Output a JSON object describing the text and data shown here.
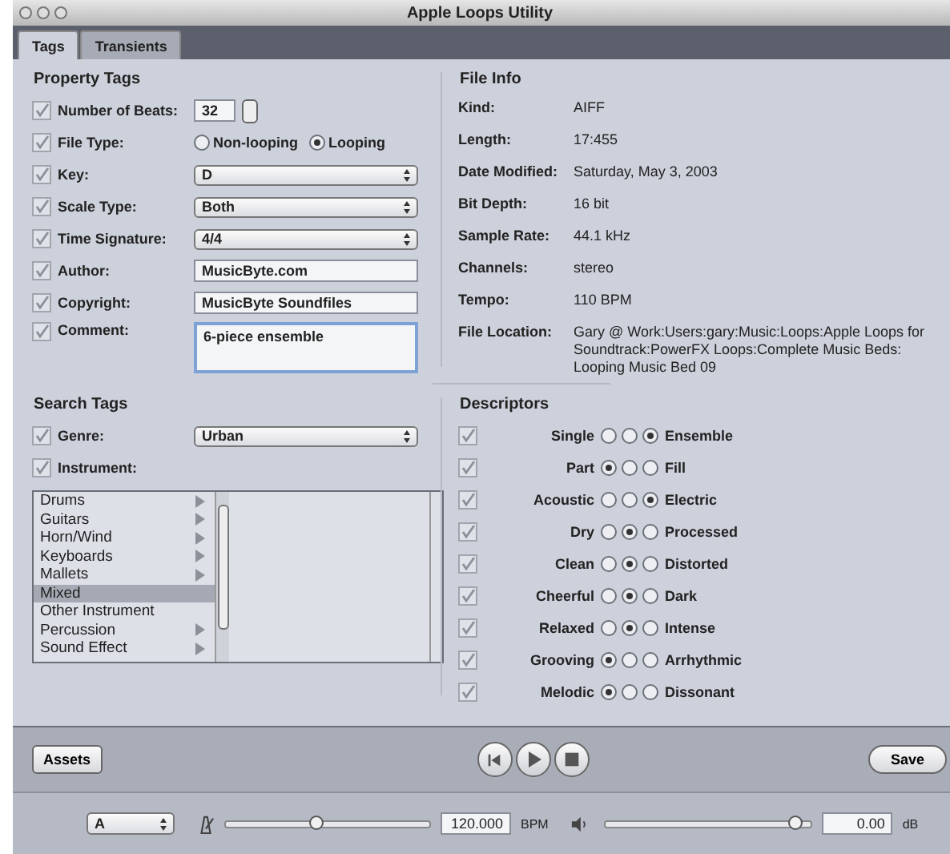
{
  "window": {
    "title": "Apple Loops Utility"
  },
  "tabs": [
    {
      "label": "Tags",
      "selected": true
    },
    {
      "label": "Transients",
      "selected": false
    }
  ],
  "property_tags": {
    "title": "Property Tags",
    "rows": [
      {
        "kind": "stepper",
        "label": "Number of Beats:",
        "checked": true,
        "value": "32"
      },
      {
        "kind": "radio",
        "label": "File Type:",
        "checked": true,
        "options": [
          {
            "label": "Non-looping",
            "selected": false
          },
          {
            "label": "Looping",
            "selected": true
          }
        ]
      },
      {
        "kind": "popup",
        "label": "Key:",
        "checked": true,
        "value": "D"
      },
      {
        "kind": "popup",
        "label": "Scale Type:",
        "checked": true,
        "value": "Both"
      },
      {
        "kind": "popup",
        "label": "Time Signature:",
        "checked": true,
        "value": "4/4"
      },
      {
        "kind": "text",
        "label": "Author:",
        "checked": true,
        "value": "MusicByte.com"
      },
      {
        "kind": "text",
        "label": "Copyright:",
        "checked": true,
        "value": "MusicByte Soundfiles"
      },
      {
        "kind": "area",
        "label": "Comment:",
        "checked": true,
        "value": "6-piece ensemble"
      }
    ]
  },
  "file_info": {
    "title": "File Info",
    "rows": [
      {
        "label": "Kind:",
        "value": "AIFF"
      },
      {
        "label": "Length:",
        "value": "17:455"
      },
      {
        "label": "Date Modified:",
        "value": "Saturday, May 3, 2003"
      },
      {
        "label": "Bit Depth:",
        "value": "16 bit"
      },
      {
        "label": "Sample Rate:",
        "value": "44.1 kHz"
      },
      {
        "label": "Channels:",
        "value": "stereo"
      },
      {
        "label": "Tempo:",
        "value": "110 BPM"
      },
      {
        "label": "File Location:",
        "value": "Gary @ Work:Users:gary:Music:Loops:Apple Loops for Soundtrack:PowerFX Loops:Complete Music Beds: Looping Music Bed 09"
      }
    ]
  },
  "search_tags": {
    "title": "Search Tags",
    "genre": {
      "label": "Genre:",
      "checked": true,
      "value": "Urban"
    },
    "instrument": {
      "label": "Instrument:",
      "checked": true
    },
    "instruments": [
      {
        "label": "Drums",
        "has_children": true,
        "selected": false
      },
      {
        "label": "Guitars",
        "has_children": true,
        "selected": false
      },
      {
        "label": "Horn/Wind",
        "has_children": true,
        "selected": false
      },
      {
        "label": "Keyboards",
        "has_children": true,
        "selected": false
      },
      {
        "label": "Mallets",
        "has_children": true,
        "selected": false
      },
      {
        "label": "Mixed",
        "has_children": false,
        "selected": true
      },
      {
        "label": "Other Instrument",
        "has_children": false,
        "selected": false
      },
      {
        "label": "Percussion",
        "has_children": true,
        "selected": false
      },
      {
        "label": "Sound Effect",
        "has_children": true,
        "selected": false
      }
    ]
  },
  "descriptors": {
    "title": "Descriptors",
    "rows": [
      {
        "left": "Single",
        "right": "Ensemble",
        "checked": true,
        "radios": [
          {
            "selected": false
          },
          {
            "selected": false
          },
          {
            "selected": true
          }
        ]
      },
      {
        "left": "Part",
        "right": "Fill",
        "checked": true,
        "radios": [
          {
            "selected": true
          },
          {
            "selected": false
          },
          {
            "selected": false
          }
        ]
      },
      {
        "left": "Acoustic",
        "right": "Electric",
        "checked": true,
        "radios": [
          {
            "selected": false
          },
          {
            "selected": false
          },
          {
            "selected": true
          }
        ]
      },
      {
        "left": "Dry",
        "right": "Processed",
        "checked": true,
        "radios": [
          {
            "selected": false
          },
          {
            "selected": true
          },
          {
            "selected": false
          }
        ]
      },
      {
        "left": "Clean",
        "right": "Distorted",
        "checked": true,
        "radios": [
          {
            "selected": false
          },
          {
            "selected": true
          },
          {
            "selected": false
          }
        ]
      },
      {
        "left": "Cheerful",
        "right": "Dark",
        "checked": true,
        "radios": [
          {
            "selected": false
          },
          {
            "selected": true
          },
          {
            "selected": false
          }
        ]
      },
      {
        "left": "Relaxed",
        "right": "Intense",
        "checked": true,
        "radios": [
          {
            "selected": false
          },
          {
            "selected": true
          },
          {
            "selected": false
          }
        ]
      },
      {
        "left": "Grooving",
        "right": "Arrhythmic",
        "checked": true,
        "radios": [
          {
            "selected": true
          },
          {
            "selected": false
          },
          {
            "selected": false
          }
        ]
      },
      {
        "left": "Melodic",
        "right": "Dissonant",
        "checked": true,
        "radios": [
          {
            "selected": true
          },
          {
            "selected": false
          },
          {
            "selected": false
          }
        ]
      }
    ]
  },
  "toolbar": {
    "assets": "Assets",
    "save": "Save"
  },
  "player": {
    "key": "A",
    "tempo": {
      "level": 0.45,
      "value": "120.000",
      "unit": "BPM"
    },
    "volume": {
      "level": 0.93,
      "value": "0.00",
      "unit": "dB"
    }
  }
}
